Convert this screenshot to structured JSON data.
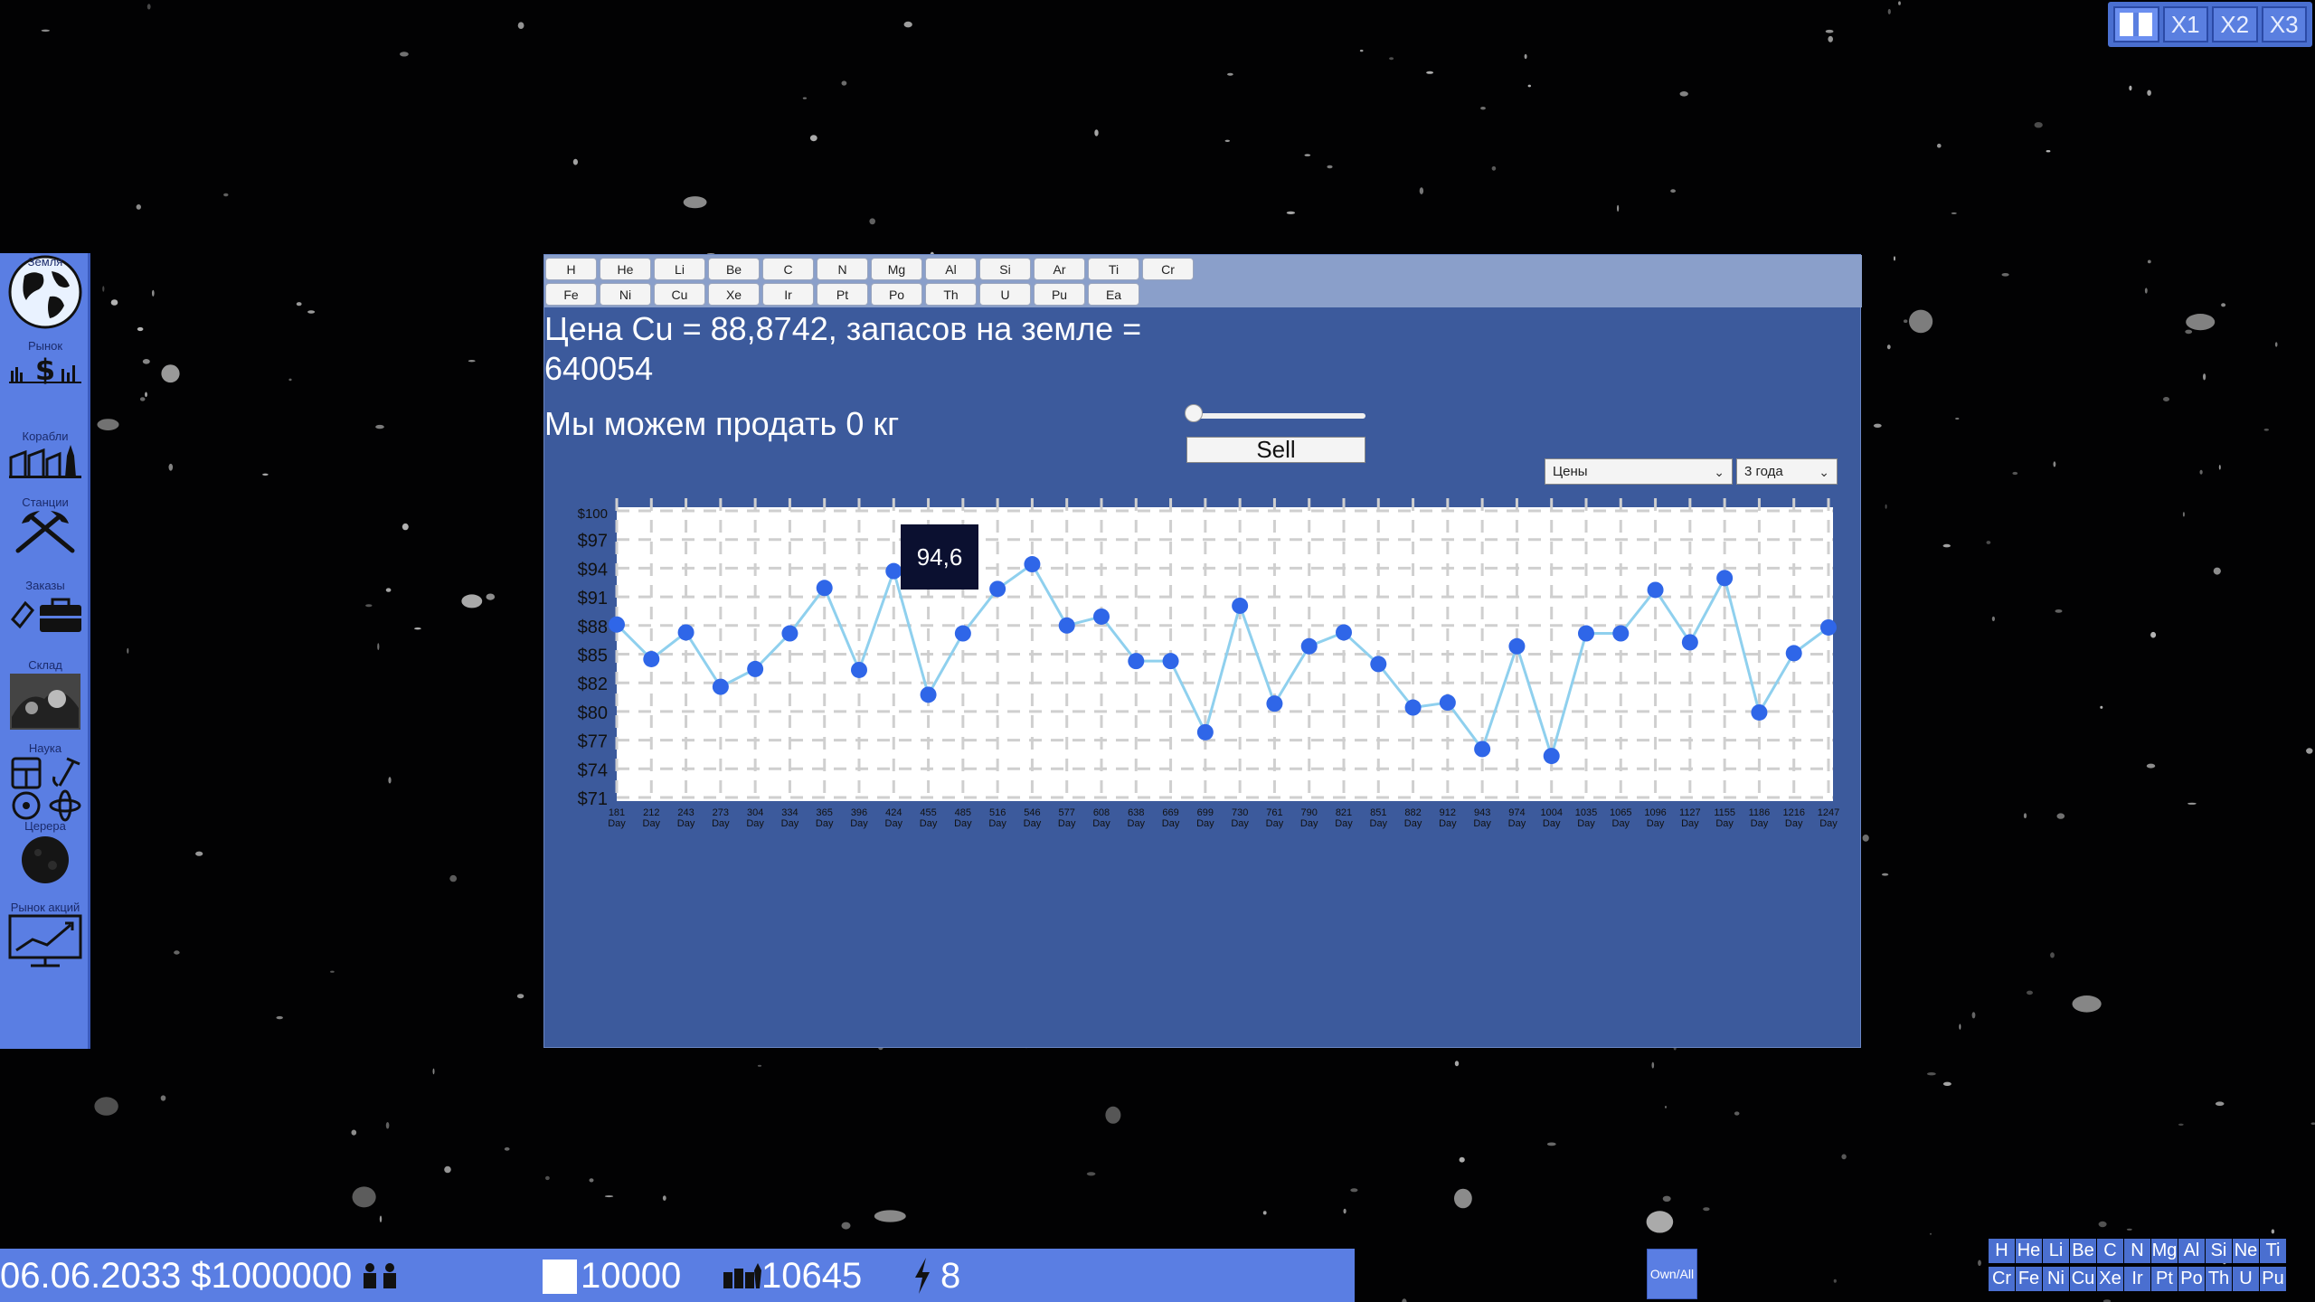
{
  "speed": {
    "pause_label": "",
    "x1": "X1",
    "x2": "X2",
    "x3": "X3"
  },
  "sidebar": {
    "items": [
      {
        "label": "Земля",
        "icon": "earth-icon"
      },
      {
        "label": "Рынок",
        "icon": "market-icon"
      },
      {
        "label": "Корабли",
        "icon": "ships-icon"
      },
      {
        "label": "Станции",
        "icon": "stations-icon"
      },
      {
        "label": "Заказы",
        "icon": "orders-icon"
      },
      {
        "label": "Склад",
        "icon": "warehouse-icon"
      },
      {
        "label": "Наука",
        "icon": "science-icon"
      },
      {
        "label": "Церера",
        "icon": "ceres-icon"
      },
      {
        "label": "Рынок акций",
        "icon": "stock-market-icon"
      }
    ]
  },
  "elements": {
    "row1": [
      "H",
      "He",
      "Li",
      "Be",
      "C",
      "N",
      "Mg",
      "Al",
      "Si",
      "Ar",
      "Ti",
      "Cr"
    ],
    "row2": [
      "Fe",
      "Ni",
      "Cu",
      "Xe",
      "Ir",
      "Pt",
      "Po",
      "Th",
      "U",
      "Pu",
      "Ea"
    ]
  },
  "market": {
    "price_text": "Цена Cu = 88,8742, запасов на земле = 640054",
    "sell_text": "Мы можем продать 0 кг",
    "sell_button": "Sell",
    "slider_value": 0,
    "select_metric": "Цены",
    "select_period": "3 года",
    "tooltip": "94,6"
  },
  "chart_data": {
    "type": "line",
    "y_ticks": [
      "$100",
      "$97",
      "$94",
      "$91",
      "$88",
      "$85",
      "$82",
      "$80",
      "$77",
      "$74",
      "$71"
    ],
    "ylim": [
      71,
      100
    ],
    "x": [
      "181\nDay",
      "212\nDay",
      "243\nDay",
      "273\nDay",
      "304\nDay",
      "334\nDay",
      "365\nDay",
      "396\nDay",
      "424\nDay",
      "455\nDay",
      "485\nDay",
      "516\nDay",
      "546\nDay",
      "577\nDay",
      "608\nDay",
      "638\nDay",
      "669\nDay",
      "699\nDay",
      "730\nDay",
      "761\nDay",
      "790\nDay",
      "821\nDay",
      "851\nDay",
      "882\nDay",
      "912\nDay",
      "943\nDay",
      "974\nDay",
      "1004\nDay",
      "1035\nDay",
      "1065\nDay",
      "1096\nDay",
      "1127\nDay",
      "1155\nDay",
      "1186\nDay",
      "1216\nDay",
      "1247\nDay"
    ],
    "values": [
      88.5,
      85.0,
      87.7,
      82.2,
      84.0,
      87.6,
      92.2,
      83.9,
      93.9,
      81.4,
      87.6,
      92.1,
      94.6,
      88.4,
      89.3,
      84.8,
      84.8,
      77.6,
      90.4,
      80.5,
      86.3,
      87.7,
      84.5,
      80.1,
      80.6,
      75.9,
      86.3,
      75.2,
      87.6,
      87.6,
      92.0,
      86.7,
      93.2,
      79.6,
      85.6,
      88.2
    ],
    "line_color": "#8fd0ee",
    "point_color": "#2f66e8",
    "grid": true
  },
  "status": {
    "date_money": "06.06.2033 $1000000",
    "storage": "10000",
    "population": "10645",
    "energy": "8",
    "own_all": "Own/All"
  },
  "mini_elements": {
    "row1": [
      "H",
      "He",
      "Li",
      "Be",
      "C",
      "N",
      "Mg",
      "Al",
      "Si",
      "Ne",
      "Ti"
    ],
    "row2": [
      "Cr",
      "Fe",
      "Ni",
      "Cu",
      "Xe",
      "Ir",
      "Pt",
      "Po",
      "Th",
      "U",
      "Pu"
    ]
  }
}
